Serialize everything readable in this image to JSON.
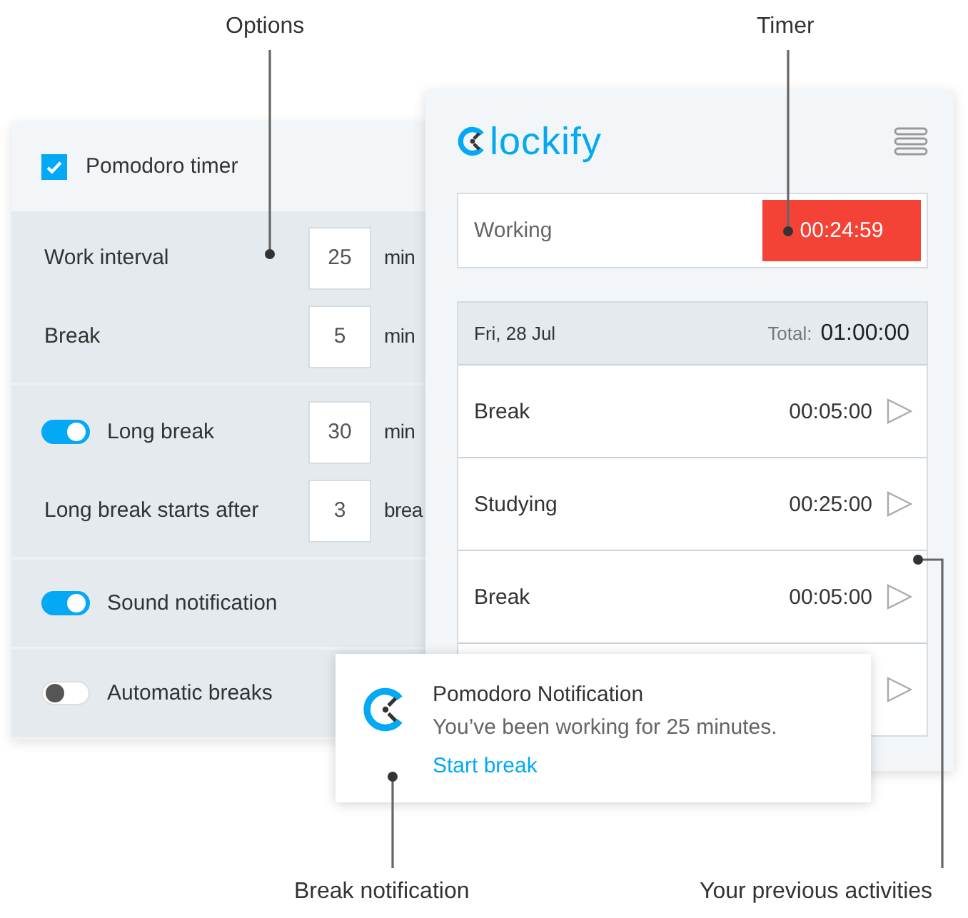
{
  "callouts": [
    {
      "label": "Options"
    },
    {
      "label": "Timer"
    },
    {
      "label": "Break notification"
    },
    {
      "label": "Your previous activities"
    }
  ],
  "options": {
    "pomodoro": {
      "label": "Pomodoro timer",
      "checked": true
    },
    "sections": [
      {
        "rows": [
          {
            "kind": "input",
            "label": "Work interval",
            "value": "25",
            "unit": "min"
          },
          {
            "kind": "input",
            "label": "Break",
            "value": "5",
            "unit": "min"
          }
        ]
      },
      {
        "rows": [
          {
            "kind": "toggle_input",
            "label": "Long break",
            "on": true,
            "value": "30",
            "unit": "min"
          },
          {
            "kind": "input",
            "label": "Long break starts after",
            "value": "3",
            "unit": "brea"
          }
        ]
      },
      {
        "rows": [
          {
            "kind": "toggle",
            "label": "Sound notification",
            "on": true
          }
        ]
      },
      {
        "rows": [
          {
            "kind": "toggle",
            "label": "Automatic breaks",
            "on": false
          }
        ]
      }
    ]
  },
  "timer": {
    "logo": "lockify",
    "description": "Working",
    "time": "00:24:59"
  },
  "entries": {
    "date": "Fri, 28 Jul",
    "total_label": "Total:",
    "total": "01:00:00",
    "rows": [
      {
        "kind": "entry",
        "name": "Break",
        "duration": "00:05:00"
      },
      {
        "kind": "entry",
        "name": "Studying",
        "duration": "00:25:00"
      },
      {
        "kind": "entry",
        "name": "Break",
        "duration": "00:05:00"
      },
      {
        "kind": "covered"
      }
    ]
  },
  "notification": {
    "title": "Pomodoro Notification",
    "body": "You’ve been working for 25 minutes.",
    "action": "Start break"
  }
}
